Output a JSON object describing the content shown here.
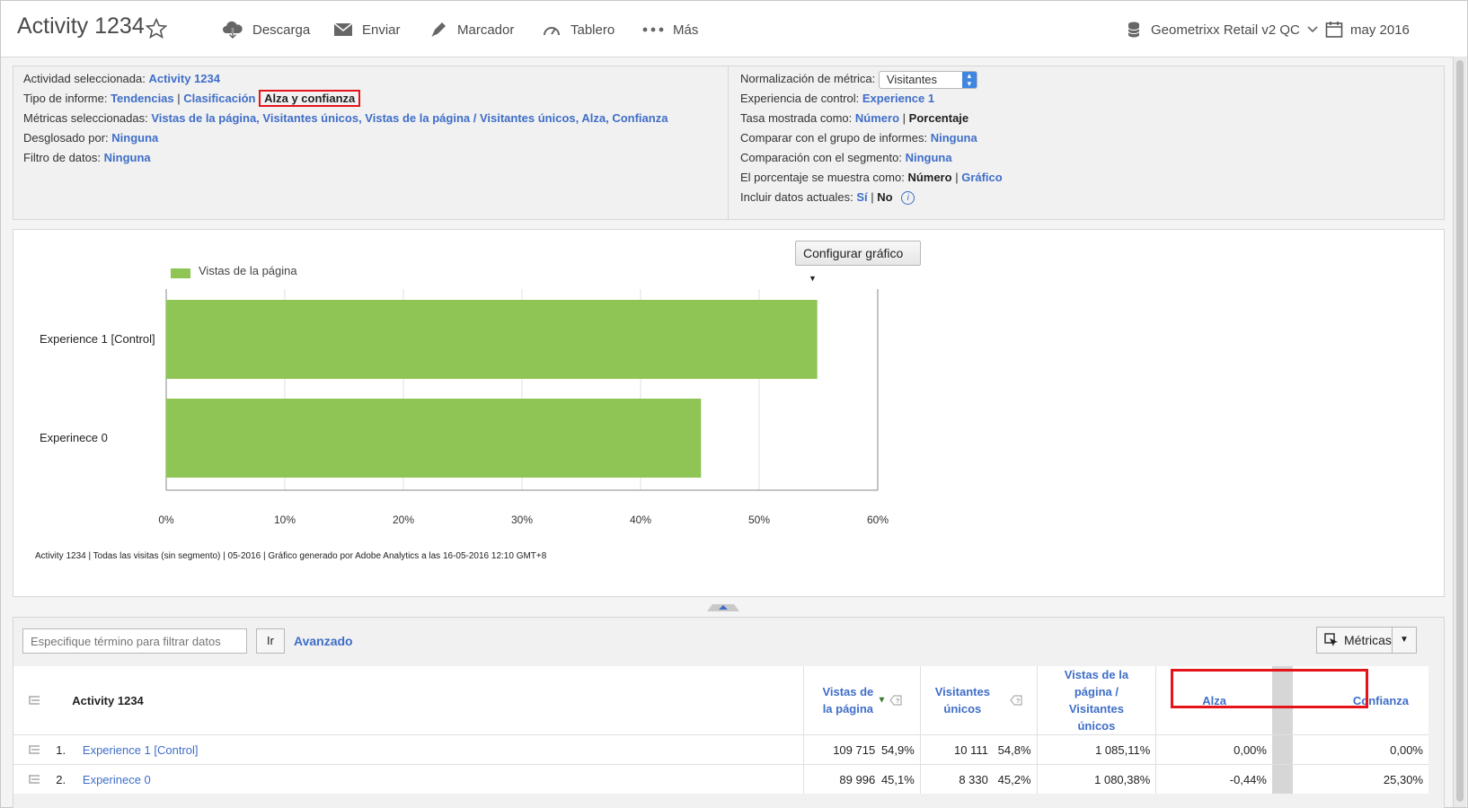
{
  "header": {
    "title": "Activity 1234",
    "toolbar": {
      "download": "Descarga",
      "send": "Enviar",
      "bookmark": "Marcador",
      "dashboard": "Tablero",
      "more": "Más"
    },
    "report_suite": "Geometrixx Retail v2 QC",
    "date": "may 2016"
  },
  "info_left": {
    "activity_label": "Actividad seleccionada:",
    "activity_value": "Activity 1234",
    "report_type_label": "Tipo de informe:",
    "report_type_trends": "Tendencias",
    "report_type_sep": "|",
    "report_type_ranked": "Clasificación",
    "report_type_lift": "Alza y confianza",
    "metrics_label": "Métricas seleccionadas:",
    "metrics_value": "Vistas de la página, Visitantes únicos, Vistas de la página / Visitantes únicos, Alza, Confianza",
    "breakdown_label": "Desglosado por:",
    "breakdown_value": "Ninguna",
    "filter_label": "Filtro de datos:",
    "filter_value": "Ninguna"
  },
  "info_right": {
    "normalization_label": "Normalización de métrica:",
    "normalization_value": "Visitantes",
    "control_label": "Experiencia de control:",
    "control_value": "Experience 1",
    "rate_label": "Tasa mostrada como:",
    "rate_number": "Número",
    "rate_sep": "|",
    "rate_percent": "Porcentaje",
    "compare_group_label": "Comparar con el grupo de informes:",
    "compare_group_value": "Ninguna",
    "compare_segment_label": "Comparación con el segmento:",
    "compare_segment_value": "Ninguna",
    "percent_label": "El porcentaje se muestra como:",
    "percent_number": "Número",
    "percent_sep": "|",
    "percent_graph": "Gráfico",
    "current_label": "Incluir datos actuales:",
    "current_yes": "Sí",
    "current_sep": "|",
    "current_no": "No",
    "info_glyph": "i"
  },
  "chart_controls": {
    "configure_label": "Configurar gráfico",
    "footnote": "Activity 1234 | Todas las visitas (sin segmento) | 05-2016 | Gráfico generado por Adobe Analytics a las 16-05-2016 12:10 GMT+8"
  },
  "chart_data": {
    "type": "bar",
    "orientation": "horizontal",
    "categories": [
      "Experience 1 [Control]",
      "Experinece 0"
    ],
    "series": [
      {
        "name": "Vistas de la página",
        "values": [
          54.9,
          45.1
        ],
        "color": "#8ec555"
      }
    ],
    "xlim": [
      0,
      60
    ],
    "xticks": [
      "0%",
      "10%",
      "20%",
      "30%",
      "40%",
      "50%",
      "60%"
    ],
    "grid": true,
    "legend": "top-left"
  },
  "table_controls": {
    "filter_placeholder": "Especifique término para filtrar datos",
    "go_label": "Ir",
    "advanced_label": "Avanzado",
    "metrics_label": "Métricas"
  },
  "table": {
    "columns": {
      "dimension": "Activity 1234",
      "page_views": "Vistas de la página",
      "unique_visitors": "Visitantes únicos",
      "ratio": "Vistas de la página / Visitantes únicos",
      "lift": "Alza",
      "confidence": "Confianza"
    },
    "rows": [
      {
        "rank": "1.",
        "name": "Experience 1 [Control]",
        "page_views": "109 715",
        "page_views_pct": "54,9%",
        "visitors": "10 111",
        "visitors_pct": "54,8%",
        "ratio": "1 085,11%",
        "lift": "0,00%",
        "confidence": "0,00%"
      },
      {
        "rank": "2.",
        "name": "Experinece 0",
        "page_views": "89 996",
        "page_views_pct": "45,1%",
        "visitors": "8 330",
        "visitors_pct": "45,2%",
        "ratio": "1 080,38%",
        "lift": "-0,44%",
        "confidence": "25,30%"
      }
    ]
  },
  "colors": {
    "link": "#3f6ec8",
    "bar": "#8ec555",
    "highlight": "#e5141b"
  }
}
